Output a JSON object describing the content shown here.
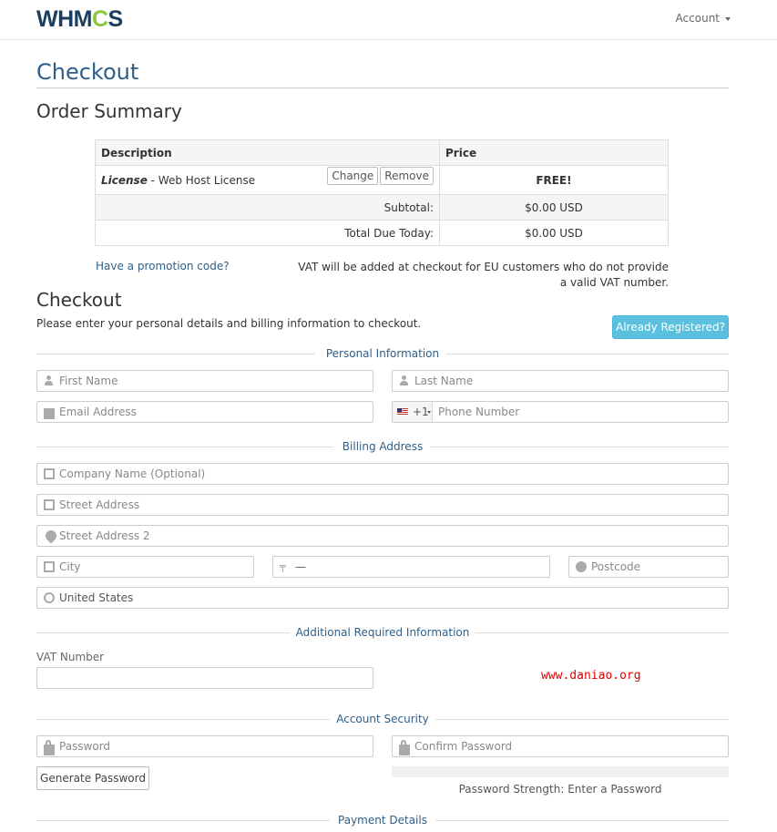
{
  "header": {
    "logo_text_pre": "WHM",
    "logo_text_gear": "C",
    "logo_text_post": "S",
    "account_label": "Account"
  },
  "page": {
    "title": "Checkout",
    "order_summary_title": "Order Summary"
  },
  "summary": {
    "col_description": "Description",
    "col_price": "Price",
    "item_category": "License",
    "item_name": " - Web Host License",
    "change_label": "Change",
    "remove_label": "Remove",
    "item_price": "FREE!",
    "subtotal_label": "Subtotal:",
    "subtotal_value": "$0.00 USD",
    "total_label": "Total Due Today:",
    "total_value": "$0.00 USD"
  },
  "promo_link": "Have a promotion code?",
  "vat_note": "VAT will be added at checkout for EU customers who do not provide a valid VAT number.",
  "checkout": {
    "title": "Checkout",
    "intro": "Please enter your personal details and billing information to checkout.",
    "already_registered": "Already Registered?"
  },
  "sections": {
    "personal": "Personal Information",
    "billing": "Billing Address",
    "additional": "Additional Required Information",
    "security": "Account Security",
    "payment": "Payment Details"
  },
  "fields": {
    "first_name": "First Name",
    "last_name": "Last Name",
    "email": "Email Address",
    "phone_code": "+1",
    "phone": "Phone Number",
    "company": "Company Name (Optional)",
    "street": "Street Address",
    "street2": "Street Address 2",
    "city": "City",
    "state": "—",
    "postcode": "Postcode",
    "country": "United States",
    "vat_label": "VAT Number",
    "vat_value": "",
    "password": "Password",
    "confirm_password": "Confirm Password"
  },
  "generate_password": "Generate Password",
  "password_strength": "Password Strength: Enter a Password",
  "watermark": "www.daniao.org"
}
